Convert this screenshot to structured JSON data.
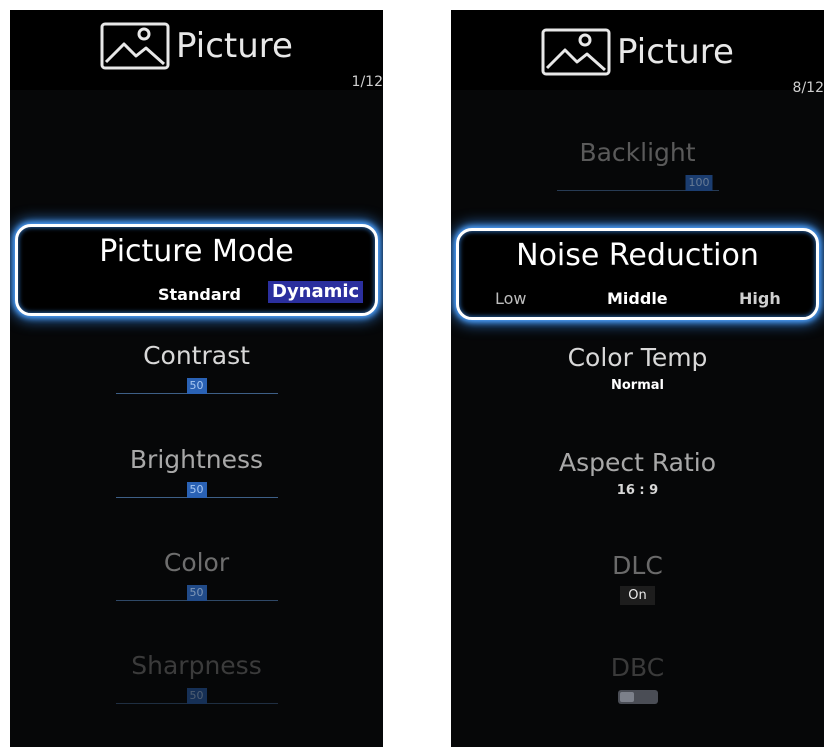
{
  "left_screen": {
    "title": "Picture",
    "page_indicator": "1/12",
    "picture_mode": {
      "label": "Picture Mode",
      "options": [
        "Standard",
        "Dynamic"
      ],
      "selected": "Dynamic"
    },
    "contrast": {
      "label": "Contrast",
      "value": "50",
      "level": 0.5
    },
    "brightness": {
      "label": "Brightness",
      "value": "50",
      "level": 0.5
    },
    "color": {
      "label": "Color",
      "value": "50",
      "level": 0.5
    },
    "sharpness": {
      "label": "Sharpness",
      "value": "50",
      "level": 0.5
    }
  },
  "right_screen": {
    "title": "Picture",
    "page_indicator": "8/12",
    "backlight": {
      "label": "Backlight",
      "value": "100",
      "level": 1.0
    },
    "noise_reduction": {
      "label": "Noise Reduction",
      "options": [
        "Low",
        "Middle",
        "High"
      ],
      "selected": "Middle"
    },
    "color_temp": {
      "label": "Color Temp",
      "value": "Normal"
    },
    "aspect_ratio": {
      "label": "Aspect Ratio",
      "value": "16 : 9"
    },
    "dlc": {
      "label": "DLC",
      "value": "On"
    },
    "dbc": {
      "label": "DBC",
      "state": "off"
    }
  },
  "colors": {
    "background": "#060708",
    "focus_border": "#ffffff",
    "focus_glow": "#4fa3ff",
    "slider_knob": "#2a62b5",
    "selected_option_bg": "#2b2f9e"
  },
  "icons": [
    "picture-icon",
    "picture-icon"
  ]
}
